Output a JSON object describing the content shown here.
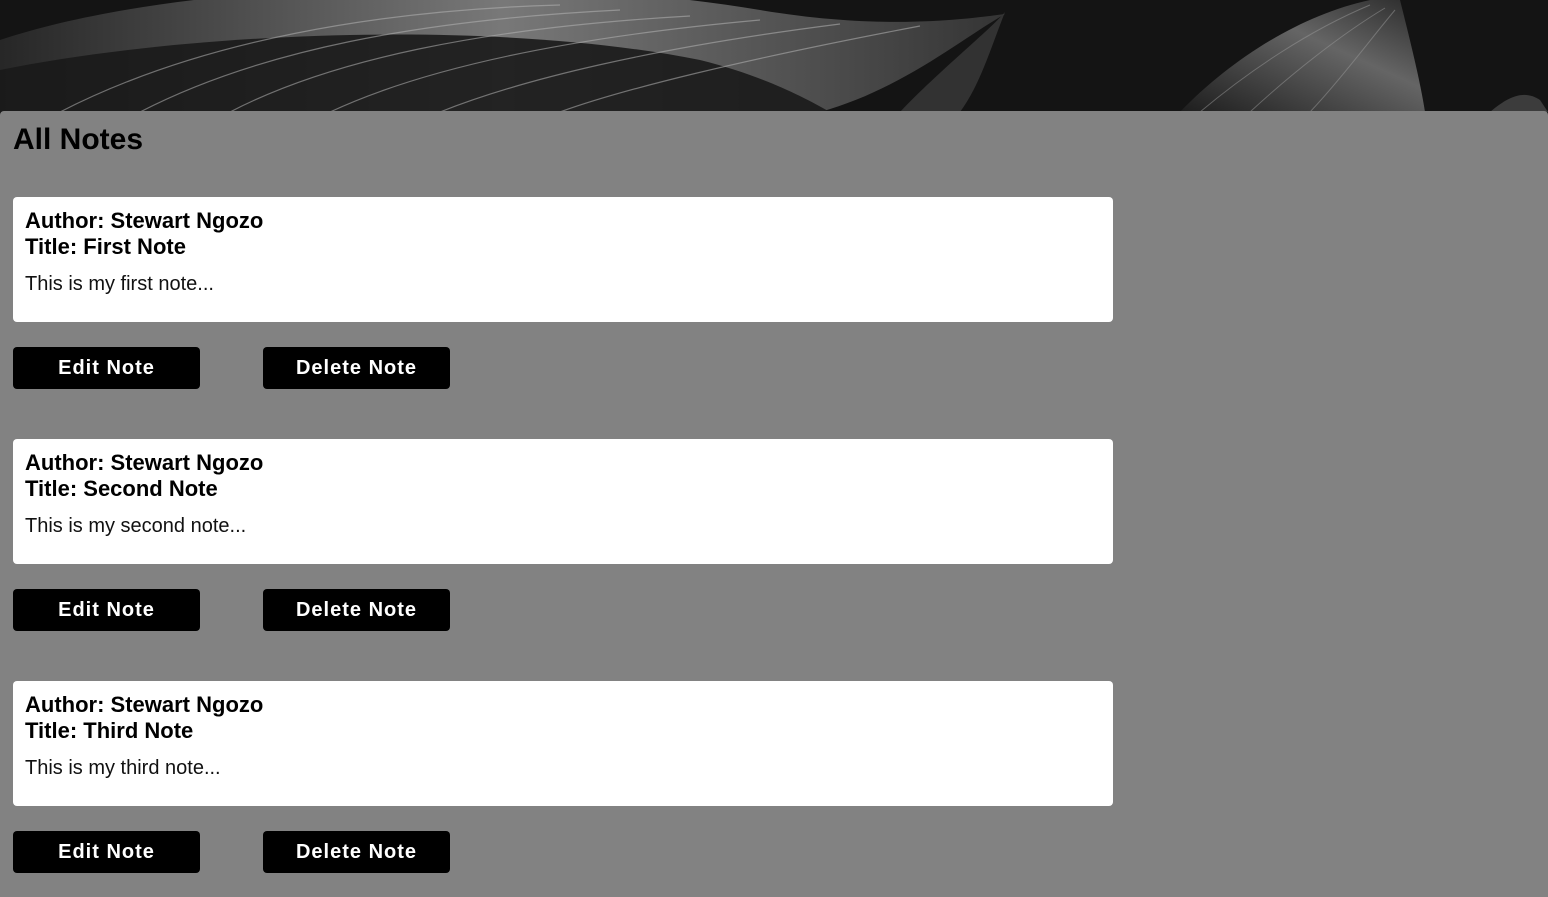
{
  "page": {
    "heading": "All Notes"
  },
  "notes": [
    {
      "author": "Author: Stewart Ngozo",
      "title": "Title: First Note",
      "body": "This is my first note...",
      "edit_label": "Edit Note",
      "delete_label": "Delete Note"
    },
    {
      "author": "Author: Stewart Ngozo",
      "title": "Title: Second Note",
      "body": "This is my second note...",
      "edit_label": "Edit Note",
      "delete_label": "Delete Note"
    },
    {
      "author": "Author: Stewart Ngozo",
      "title": "Title: Third Note",
      "body": "This is my third note...",
      "edit_label": "Edit Note",
      "delete_label": "Delete Note"
    }
  ],
  "colors": {
    "panel_background": "#828282",
    "card_background": "#ffffff",
    "button_background": "#000000",
    "button_text": "#ffffff"
  }
}
